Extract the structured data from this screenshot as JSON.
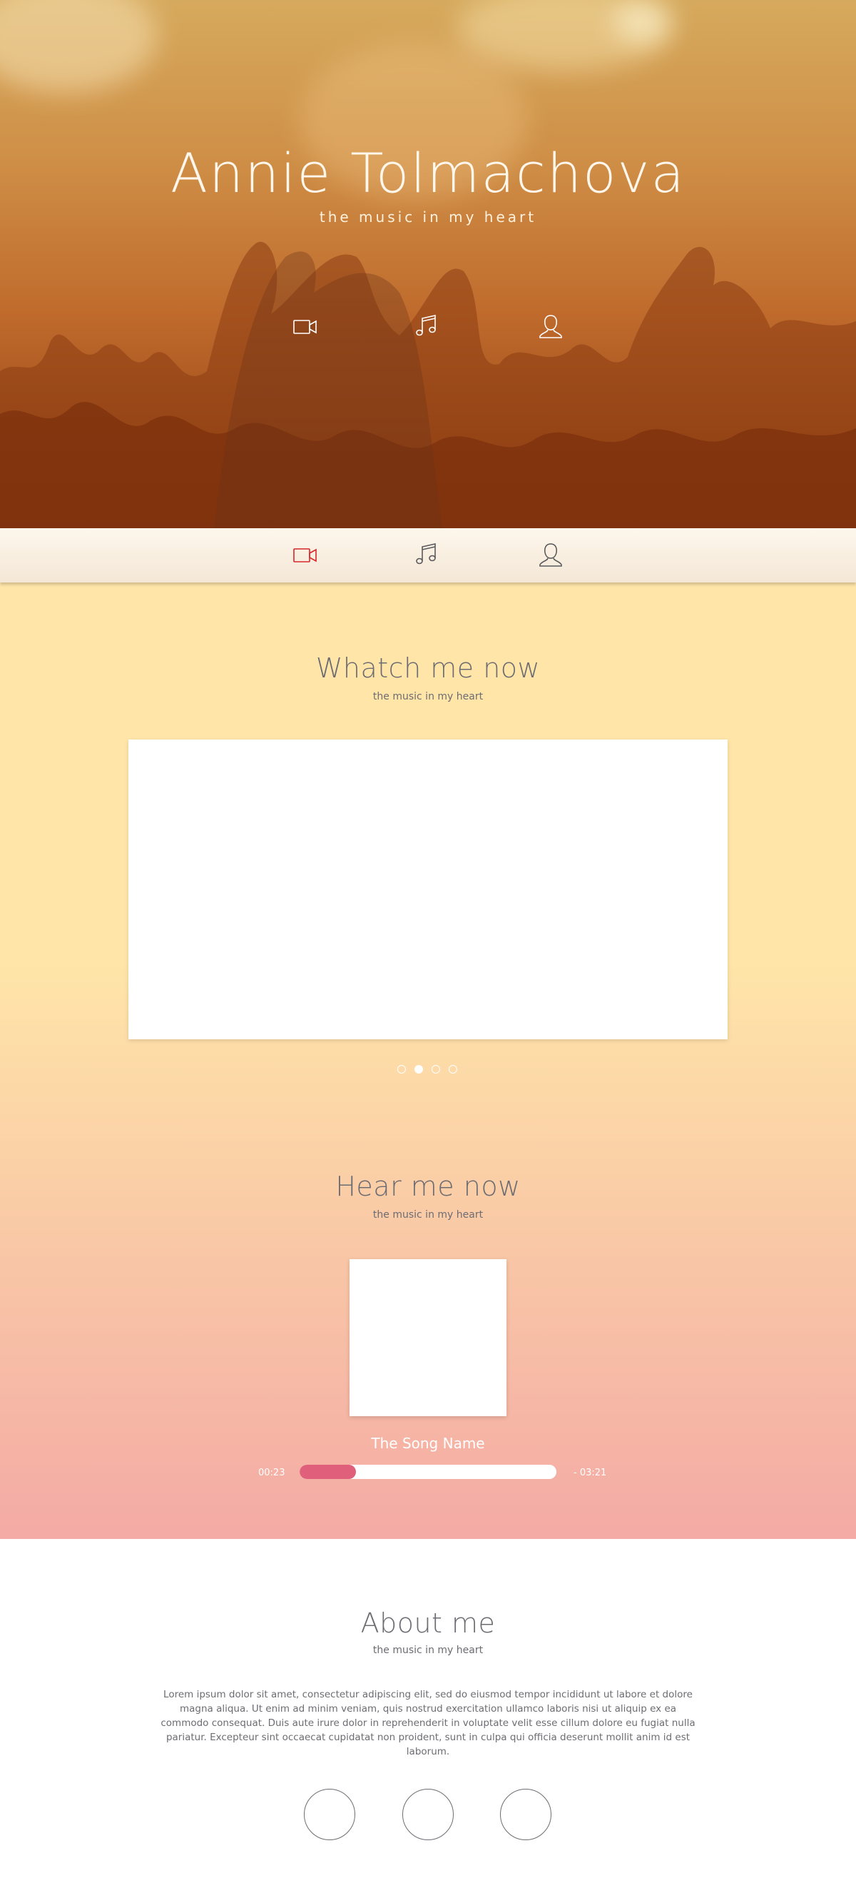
{
  "hero": {
    "title": "Annie Tolmachova",
    "subtitle": "the music in my heart",
    "icons": [
      "video-camera-icon",
      "music-note-icon",
      "user-icon"
    ]
  },
  "navbar": {
    "icons": [
      "video-camera-icon",
      "music-note-icon",
      "user-icon"
    ],
    "active_index": 0,
    "active_color": "#d8262b",
    "icon_color": "#5a5a5e"
  },
  "watch": {
    "title": "Whatch me now",
    "subtitle": "the music in my heart",
    "carousel_dots": 4,
    "active_dot": 1
  },
  "hear": {
    "title": "Hear me now",
    "subtitle": "the music in my heart",
    "song_name": "The Song Name",
    "elapsed": "00:23",
    "remaining": "- 03:21",
    "progress_fraction": 0.22,
    "progress_color": "#e0607c"
  },
  "about": {
    "title": "About me",
    "subtitle": "the music in my heart",
    "text": "Lorem ipsum dolor sit amet, consectetur adipiscing elit, sed do eiusmod tempor incididunt ut labore et dolore magna aliqua. Ut enim ad minim veniam, quis nostrud exercitation ullamco laboris nisi ut aliquip ex ea commodo consequat. Duis aute irure dolor in reprehenderit in voluptate velit esse cillum dolore eu fugiat nulla pariatur. Excepteur sint occaecat cupidatat non proident, sunt in culpa qui officia deserunt mollit anim id est laborum.",
    "social_circles": 3
  }
}
